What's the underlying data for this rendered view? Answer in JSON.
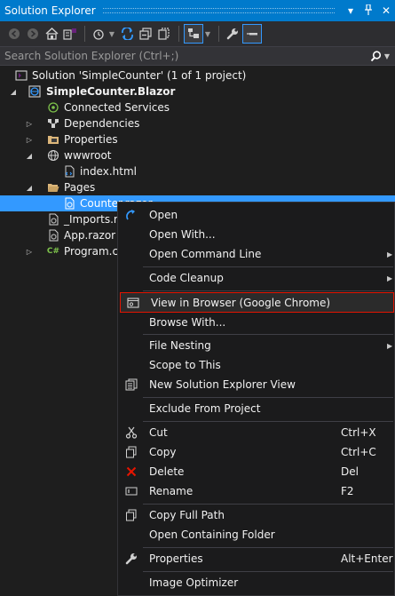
{
  "window": {
    "title": "Solution Explorer",
    "dropdown_glyph": "▾",
    "pin_glyph": "ᵖ",
    "close_glyph": "✕"
  },
  "search": {
    "placeholder": "Search Solution Explorer (Ctrl+;)",
    "icon": "search-icon"
  },
  "tree": {
    "solution": "Solution 'SimpleCounter' (1 of 1 project)",
    "project": "SimpleCounter.Blazor",
    "connected_services": "Connected Services",
    "dependencies": "Dependencies",
    "properties": "Properties",
    "wwwroot": "wwwroot",
    "index_html": "index.html",
    "pages": "Pages",
    "counter": "Counter.razor",
    "imports": "_Imports.razor",
    "app": "App.razor",
    "program": "Program.cs"
  },
  "menu": {
    "open": "Open",
    "open_with": "Open With...",
    "open_command_line": "Open Command Line",
    "code_cleanup": "Code Cleanup",
    "view_in_browser": "View in Browser (Google Chrome)",
    "browse_with": "Browse With...",
    "file_nesting": "File Nesting",
    "scope_to_this": "Scope to This",
    "new_view": "New Solution Explorer View",
    "exclude": "Exclude From Project",
    "cut": "Cut",
    "cut_shortcut": "Ctrl+X",
    "copy": "Copy",
    "copy_shortcut": "Ctrl+C",
    "delete": "Delete",
    "delete_shortcut": "Del",
    "rename": "Rename",
    "rename_shortcut": "F2",
    "copy_full_path": "Copy Full Path",
    "open_containing_folder": "Open Containing Folder",
    "properties": "Properties",
    "properties_shortcut": "Alt+Enter",
    "image_optimizer": "Image Optimizer",
    "submenu_arrow": "▶"
  },
  "colors": {
    "accent": "#007acc",
    "selection": "#3399ff",
    "highlight_border": "#e51400",
    "background": "#1e1e1e",
    "menu_background": "#1b1b1c"
  }
}
